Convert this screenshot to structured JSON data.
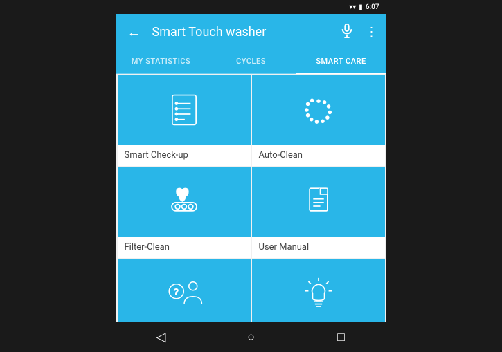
{
  "statusBar": {
    "time": "6:07",
    "icons": [
      "wifi",
      "battery"
    ]
  },
  "header": {
    "title": "Smart Touch washer",
    "backLabel": "←",
    "micLabel": "🎤",
    "moreLabel": "⋮"
  },
  "tabs": [
    {
      "id": "my-statistics",
      "label": "MY STATISTICS",
      "active": false
    },
    {
      "id": "cycles",
      "label": "CYCLES",
      "active": false
    },
    {
      "id": "smart-care",
      "label": "SMART CARE",
      "active": true
    }
  ],
  "cards": [
    {
      "id": "smart-checkup",
      "label": "Smart Check-up",
      "icon": "checklist"
    },
    {
      "id": "auto-clean",
      "label": "Auto-Clean",
      "icon": "dots-fan"
    },
    {
      "id": "filter-clean",
      "label": "Filter-Clean",
      "icon": "filter"
    },
    {
      "id": "user-manual",
      "label": "User Manual",
      "icon": "document"
    },
    {
      "id": "help",
      "label": "",
      "icon": "person-question"
    },
    {
      "id": "lightbulb",
      "label": "",
      "icon": "lightbulb"
    }
  ],
  "navBar": {
    "back": "◁",
    "home": "○",
    "recent": "□"
  }
}
